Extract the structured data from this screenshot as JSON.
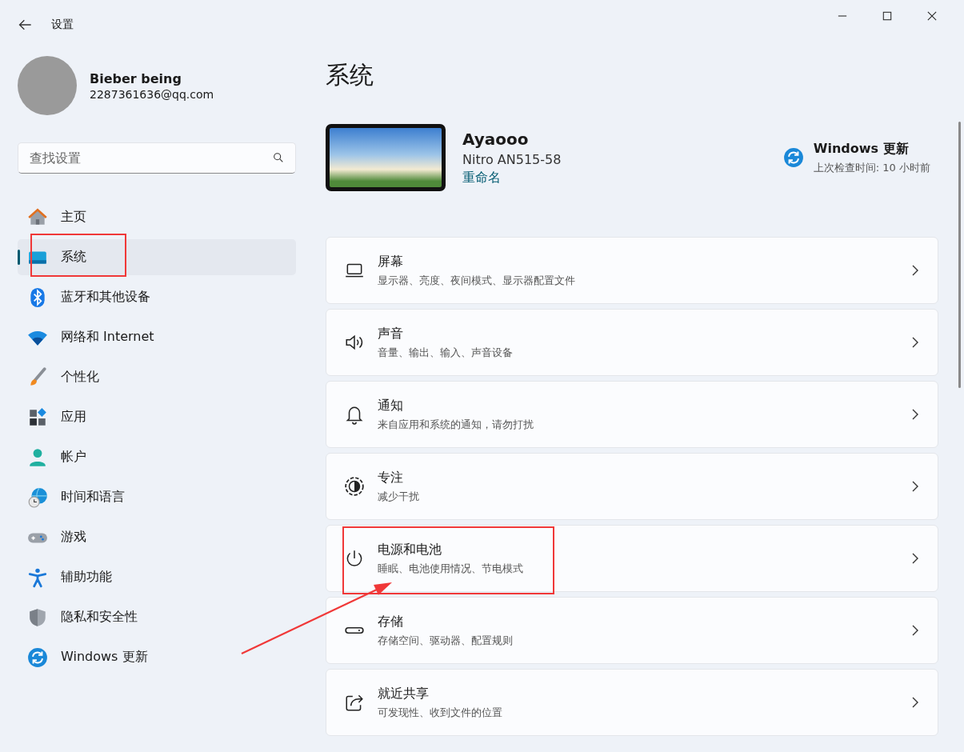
{
  "window": {
    "title": "设置"
  },
  "profile": {
    "name": "Bieber being",
    "email": "2287361636@qq.com"
  },
  "search": {
    "placeholder": "查找设置"
  },
  "sidebar": {
    "items": [
      {
        "label": "主页",
        "selected": false,
        "annotated": false
      },
      {
        "label": "系统",
        "selected": true,
        "annotated": true
      },
      {
        "label": "蓝牙和其他设备",
        "selected": false,
        "annotated": false
      },
      {
        "label": "网络和 Internet",
        "selected": false,
        "annotated": false
      },
      {
        "label": "个性化",
        "selected": false,
        "annotated": false
      },
      {
        "label": "应用",
        "selected": false,
        "annotated": false
      },
      {
        "label": "帐户",
        "selected": false,
        "annotated": false
      },
      {
        "label": "时间和语言",
        "selected": false,
        "annotated": false
      },
      {
        "label": "游戏",
        "selected": false,
        "annotated": false
      },
      {
        "label": "辅助功能",
        "selected": false,
        "annotated": false
      },
      {
        "label": "隐私和安全性",
        "selected": false,
        "annotated": false
      },
      {
        "label": "Windows 更新",
        "selected": false,
        "annotated": false
      }
    ]
  },
  "page_title": "系统",
  "device": {
    "name": "Ayaooo",
    "model": "Nitro AN515-58",
    "rename_link": "重命名"
  },
  "update": {
    "title": "Windows 更新",
    "subtitle": "上次检查时间: 10 小时前"
  },
  "cards": [
    {
      "title": "屏幕",
      "subtitle": "显示器、亮度、夜间模式、显示器配置文件",
      "annotated": false
    },
    {
      "title": "声音",
      "subtitle": "音量、输出、输入、声音设备",
      "annotated": false
    },
    {
      "title": "通知",
      "subtitle": "来自应用和系统的通知，请勿打扰",
      "annotated": false
    },
    {
      "title": "专注",
      "subtitle": "减少干扰",
      "annotated": false
    },
    {
      "title": "电源和电池",
      "subtitle": "睡眠、电池使用情况、节电模式",
      "annotated": true
    },
    {
      "title": "存储",
      "subtitle": "存储空间、驱动器、配置规则",
      "annotated": false
    },
    {
      "title": "就近共享",
      "subtitle": "可发现性、收到文件的位置",
      "annotated": false
    }
  ]
}
